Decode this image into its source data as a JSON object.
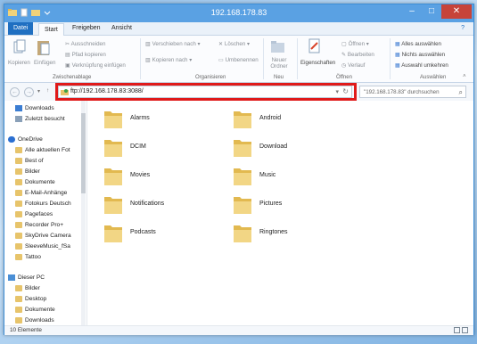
{
  "window": {
    "title": "192.168.178.83"
  },
  "ribbon_tabs": [
    "Datei",
    "Start",
    "Freigeben",
    "Ansicht"
  ],
  "ribbon": {
    "clipboard": {
      "copy": "Kopieren",
      "paste": "Einfügen",
      "cut": "Ausschneiden",
      "copy_path": "Pfad kopieren",
      "paste_shortcut": "Verknüpfung einfügen",
      "group": "Zwischenablage"
    },
    "organize": {
      "move_to": "Verschieben nach",
      "copy_to": "Kopieren nach",
      "delete": "Löschen",
      "rename": "Umbenennen",
      "group": "Organisieren"
    },
    "new": {
      "new_folder": "Neuer Ordner",
      "group": "Neu"
    },
    "open": {
      "properties": "Eigenschaften",
      "open": "Öffnen",
      "edit": "Bearbeiten",
      "history": "Verlauf",
      "group": "Öffnen"
    },
    "select": {
      "select_all": "Alles auswählen",
      "select_none": "Nichts auswählen",
      "invert": "Auswahl umkehren",
      "group": "Auswählen"
    }
  },
  "address": {
    "value": "ftp://192.168.178.83:3088/"
  },
  "search": {
    "placeholder": "\"192.168.178.83\" durchsuchen"
  },
  "nav": {
    "items": [
      {
        "label": "Downloads",
        "icon": "downloads-icon"
      },
      {
        "label": "Zuletzt besucht",
        "icon": "recent-icon"
      },
      {
        "label": "OneDrive",
        "icon": "onedrive-icon"
      },
      {
        "label": "Alle aktuellen Fot",
        "icon": "folder-icon"
      },
      {
        "label": "Best of",
        "icon": "folder-icon"
      },
      {
        "label": "Bilder",
        "icon": "folder-icon"
      },
      {
        "label": "Dokumente",
        "icon": "folder-icon"
      },
      {
        "label": "E-Mail-Anhänge",
        "icon": "folder-icon"
      },
      {
        "label": "Fotokurs Deutsch",
        "icon": "folder-icon"
      },
      {
        "label": "Pagefaces",
        "icon": "folder-icon"
      },
      {
        "label": "Recorder Pro+",
        "icon": "folder-icon"
      },
      {
        "label": "SkyDrive Camera",
        "icon": "folder-icon"
      },
      {
        "label": "SleeveMusic_fSa",
        "icon": "folder-icon"
      },
      {
        "label": "Tattoo",
        "icon": "folder-icon"
      },
      {
        "label": "Dieser PC",
        "icon": "pc-icon"
      },
      {
        "label": "Bilder",
        "icon": "folder-icon"
      },
      {
        "label": "Desktop",
        "icon": "folder-icon"
      },
      {
        "label": "Dokumente",
        "icon": "folder-icon"
      },
      {
        "label": "Downloads",
        "icon": "folder-icon"
      }
    ]
  },
  "content": {
    "folders": [
      "Alarms",
      "Android",
      "DCIM",
      "Download",
      "Movies",
      "Music",
      "Notifications",
      "Pictures",
      "Podcasts",
      "Ringtones"
    ]
  },
  "status": {
    "count": "10 Elemente"
  },
  "colors": {
    "titlebar": "#5aa1e3",
    "file_tab": "#1f6fc1",
    "highlight": "#e01a1a",
    "folder": "#e7c46b"
  }
}
